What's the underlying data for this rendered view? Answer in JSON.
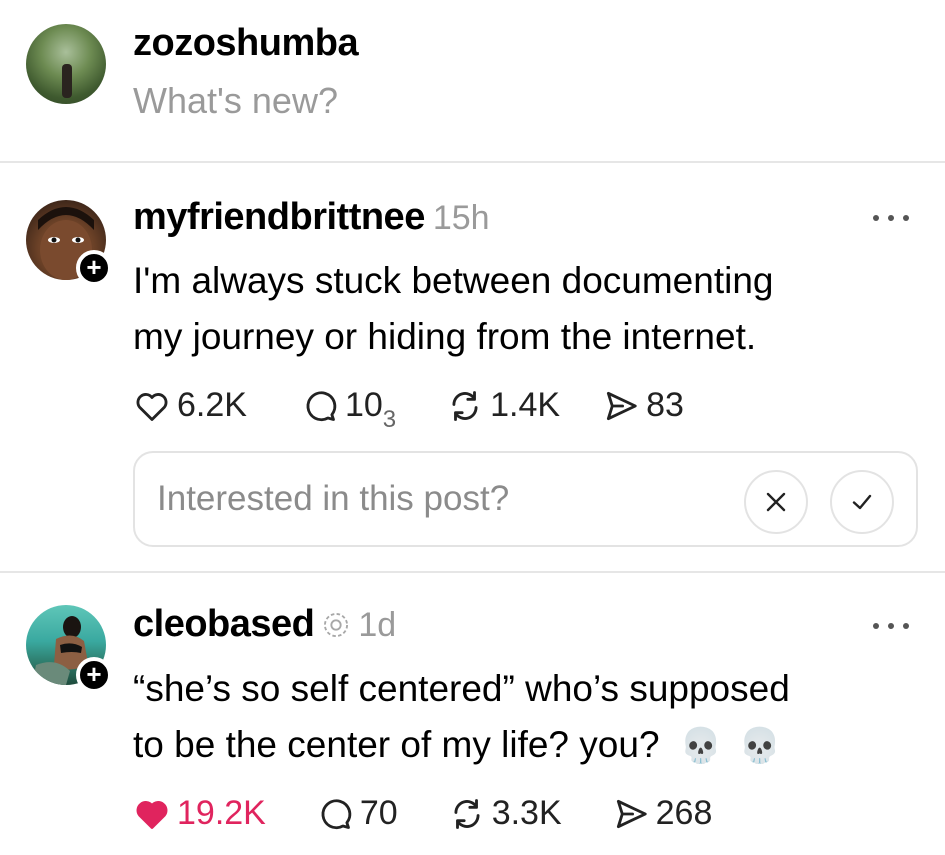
{
  "composer": {
    "username": "zozoshumba",
    "placeholder": "What's new?"
  },
  "posts": [
    {
      "author": "myfriendbrittnee",
      "time": "15h",
      "text_line1": "I'm always stuck between documenting",
      "text_line2": "my journey or hiding from the internet.",
      "likes": "6.2K",
      "liked": false,
      "replies": "10",
      "replies_sub": "3",
      "reposts": "1.4K",
      "shares": "83",
      "interest_prompt": "Interested in this post?"
    },
    {
      "author": "cleobased",
      "time": "1d",
      "text_line1": "“she’s so self centered” who’s supposed",
      "text_line2": "to be the center of my life? you?",
      "emoji": "💀",
      "likes": "19.2K",
      "liked": true,
      "replies": "70",
      "reposts": "3.3K",
      "shares": "268"
    }
  ],
  "colors": {
    "liked": "#e0245e",
    "muted": "#9a9a9a",
    "divider": "#e6e6e6"
  },
  "icons": [
    "heart-icon",
    "comment-icon",
    "repost-icon",
    "share-icon",
    "more-icon",
    "plus-icon",
    "close-icon",
    "check-icon",
    "threads-badge-icon"
  ]
}
